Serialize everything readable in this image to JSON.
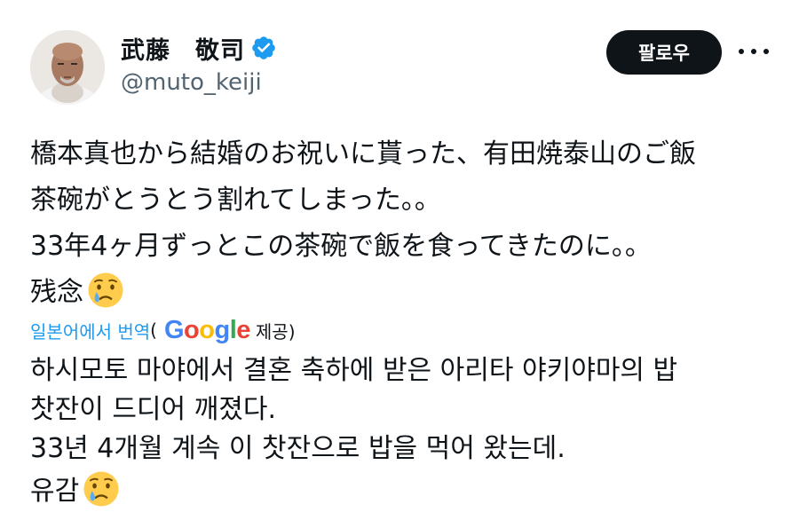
{
  "user": {
    "display_name": "武藤　敬司",
    "handle": "@muto_keiji",
    "verified": true,
    "verified_color": "#1d9bf0"
  },
  "actions": {
    "follow_label": "팔로우",
    "more_icon": "more-horizontal-icon"
  },
  "tweet": {
    "lines": [
      "橋本真也から結婚のお祝いに貰った、有田焼泰山のご飯",
      "茶碗がとうとう割れてしまった。。",
      "33年4ヶ月ずっとこの茶碗で飯を食ってきたのに。。",
      "残念"
    ],
    "emoji": "crying-face-icon"
  },
  "translation": {
    "link_label": "일본어에서 번역",
    "open_paren": "(",
    "provider": "Google",
    "provided_by": "제공)",
    "lines": [
      "하시모토 마야에서 결혼 축하에 받은 아리타 야키야마의 밥",
      "찻잔이 드디어 깨졌다.",
      "33년 4개월 계속 이 찻잔으로 밥을 먹어 왔는데.",
      "유감"
    ]
  },
  "colors": {
    "link": "#1d9bf0",
    "text": "#0f1419",
    "secondary": "#536471",
    "button_bg": "#0f1419"
  }
}
